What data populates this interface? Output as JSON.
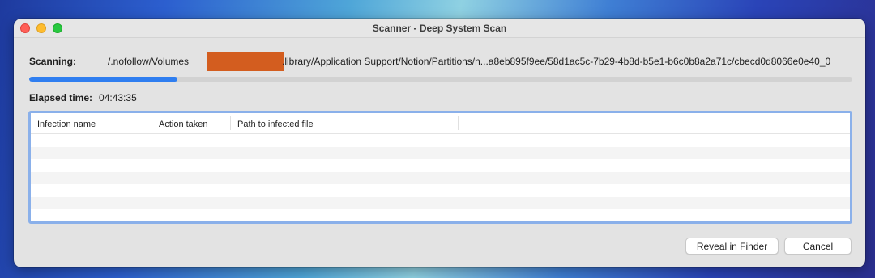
{
  "window": {
    "title": "Scanner - Deep System Scan"
  },
  "scan": {
    "label": "Scanning:",
    "path_prefix": "/.nofollow/Volumes",
    "path_suffix": ".library/Application Support/Notion/Partitions/n...a8eb895f9ee/58d1ac5c-7b29-4b8d-b5e1-b6c0b8a2a71c/cbecd0d8066e0e40_0",
    "progress_fraction": 0.18,
    "redaction_color": "#d35d1f"
  },
  "elapsed": {
    "label": "Elapsed time:",
    "value": "04:43:35"
  },
  "table": {
    "columns": [
      "Infection name",
      "Action taken",
      "Path to infected file",
      ""
    ],
    "rows": []
  },
  "buttons": {
    "reveal": "Reveal in Finder",
    "cancel": "Cancel"
  },
  "colors": {
    "accent": "#2f7ef0",
    "focus_ring": "#8ab0ea"
  }
}
